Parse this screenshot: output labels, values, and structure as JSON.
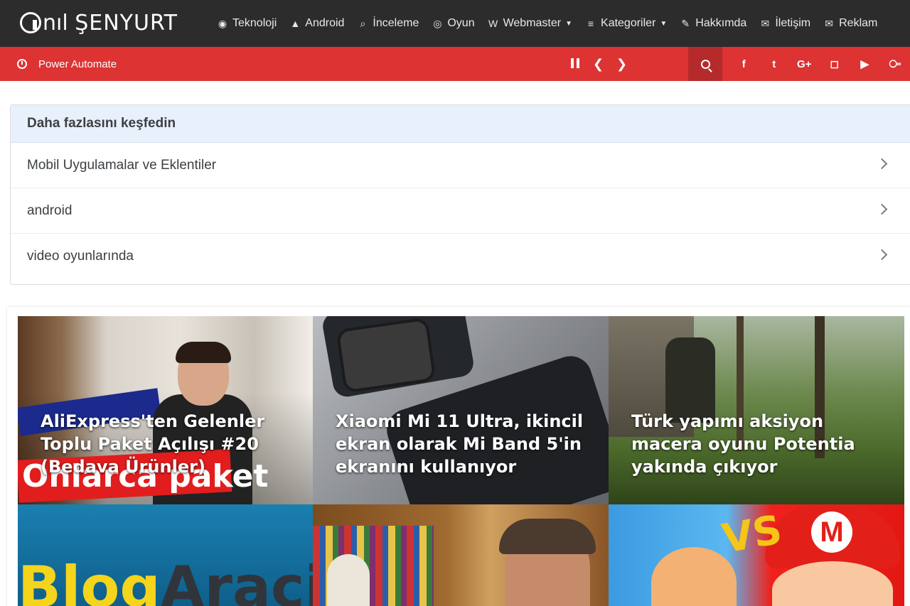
{
  "brand": {
    "logo_thin": "nıl",
    "logo_bold": "ŞENYURT"
  },
  "nav": [
    {
      "label": "Teknoloji",
      "icon": "compass-icon",
      "glyph": "◉"
    },
    {
      "label": "Android",
      "icon": "android-icon",
      "glyph": "▲"
    },
    {
      "label": "İnceleme",
      "icon": "search-icon",
      "glyph": "⌕"
    },
    {
      "label": "Oyun",
      "icon": "gamepad-icon",
      "glyph": "◎"
    },
    {
      "label": "Webmaster",
      "icon": "vine-icon",
      "glyph": "W",
      "dropdown": true
    },
    {
      "label": "Kategoriler",
      "icon": "bars-icon",
      "glyph": "≡",
      "dropdown": true
    },
    {
      "label": "Hakkımda",
      "icon": "edit-icon",
      "glyph": "✎"
    },
    {
      "label": "İletişim",
      "icon": "envelope-icon",
      "glyph": "✉"
    },
    {
      "label": "Reklam",
      "icon": "envelope-icon",
      "glyph": "✉"
    }
  ],
  "ticker": {
    "text": "Power Automate"
  },
  "social": [
    {
      "name": "facebook-icon",
      "glyph": "f"
    },
    {
      "name": "twitter-icon",
      "glyph": "t"
    },
    {
      "name": "google-plus-icon",
      "glyph": "G+"
    },
    {
      "name": "instagram-icon",
      "glyph": "◻"
    },
    {
      "name": "youtube-icon",
      "glyph": "▶"
    },
    {
      "name": "rss-icon",
      "glyph": "⧃"
    }
  ],
  "discover": {
    "heading": "Daha fazlasını keşfedin",
    "items": [
      "Mobil Uygulamalar ve Eklentiler",
      "android",
      "video oyunlarında"
    ]
  },
  "tiles": [
    {
      "title": "AliExpress'ten Gelenler Toplu Paket Açılışı #20 (Bedava Ürünler)",
      "overlay_text": "Onlarca paket"
    },
    {
      "title": "Xiaomi Mi 11 Ultra, ikincil ekran olarak Mi Band 5'in ekranını kullanıyor"
    },
    {
      "title": "Türk yapımı aksiyon macera oyunu Potentia yakında çıkıyor"
    },
    {
      "title": "",
      "overlay_text_a": "Blog",
      "overlay_text_b": "Araci"
    },
    {
      "title": ""
    },
    {
      "title": "",
      "overlay_text": "VS"
    }
  ],
  "colors": {
    "nav_bg": "#2c2c2c",
    "accent_red": "#dd3333",
    "search_bg": "#b52a2a"
  }
}
